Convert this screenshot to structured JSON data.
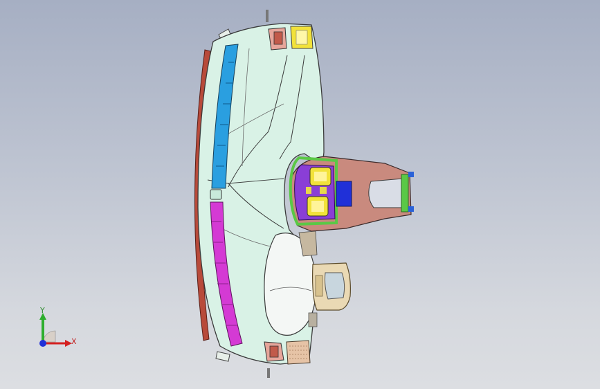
{
  "viewport": {
    "background_top": "#a6afc3",
    "background_bottom": "#dcdee2"
  },
  "model": {
    "colors": {
      "dash_body": "#d9f2e6",
      "dash_edge": "#3a3a3a",
      "vent_blue": "#2a9fe0",
      "vent_magenta": "#d43ad4",
      "windshield_trim": "#b84a3a",
      "console_body": "#c98a7e",
      "console_frame": "#5ac846",
      "center_panel": "#8a3ed6",
      "switch_yellow": "#f2e23a",
      "steering_wheel": "#ead9b4",
      "gauge_white": "#f4f7f5"
    }
  },
  "triad": {
    "x_label": "X",
    "y_label": "Y",
    "x_color": "#d42020",
    "y_color": "#2eae2e",
    "z_color": "#2030d8"
  }
}
